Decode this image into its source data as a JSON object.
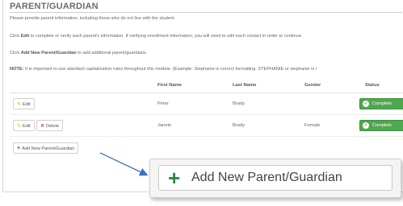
{
  "section": {
    "title": "PARENT/GUARDIAN",
    "intro": "Please provide parent information, including those who do not live with the student.",
    "instruction_edit_prefix": "Click ",
    "instruction_edit_bold": "Edit",
    "instruction_edit_suffix": " to complete or verify each parent's information. If verifying enrollment information, you will need to edit each contact in order to continue.",
    "instruction_add_prefix": "Click ",
    "instruction_add_bold": "Add New Parent/Guardian",
    "instruction_add_suffix": " to add additional parent/guardians.",
    "note_bold": "NOTE:",
    "note_text": " It is important to use standard capitalization rules throughout this module. (Example: Stephanie is correct formatting. STEPHANIE or stephanie is i"
  },
  "table": {
    "headers": {
      "first_name": "First Name",
      "last_name": "Last Name",
      "gender": "Gender",
      "status": "Status"
    },
    "rows": [
      {
        "edit_label": "Edit",
        "first_name": "Peter",
        "last_name": "Brady",
        "gender": "",
        "status": "Complete"
      },
      {
        "edit_label": "Edit",
        "delete_label": "Delete",
        "first_name": "Janele",
        "last_name": "Brady",
        "gender": "Female",
        "status": "Complete"
      }
    ]
  },
  "add_button": {
    "label": "Add New Parent/Guardian",
    "icon": "plus-icon"
  },
  "zoom_callout": {
    "label": "Add New Parent/Guardian",
    "icon": "plus-icon"
  },
  "colors": {
    "status_complete": "#4fa84f",
    "plus_green": "#2e8b3e",
    "delete_red": "#d33333",
    "arrow_blue": "#3b6fc6"
  }
}
